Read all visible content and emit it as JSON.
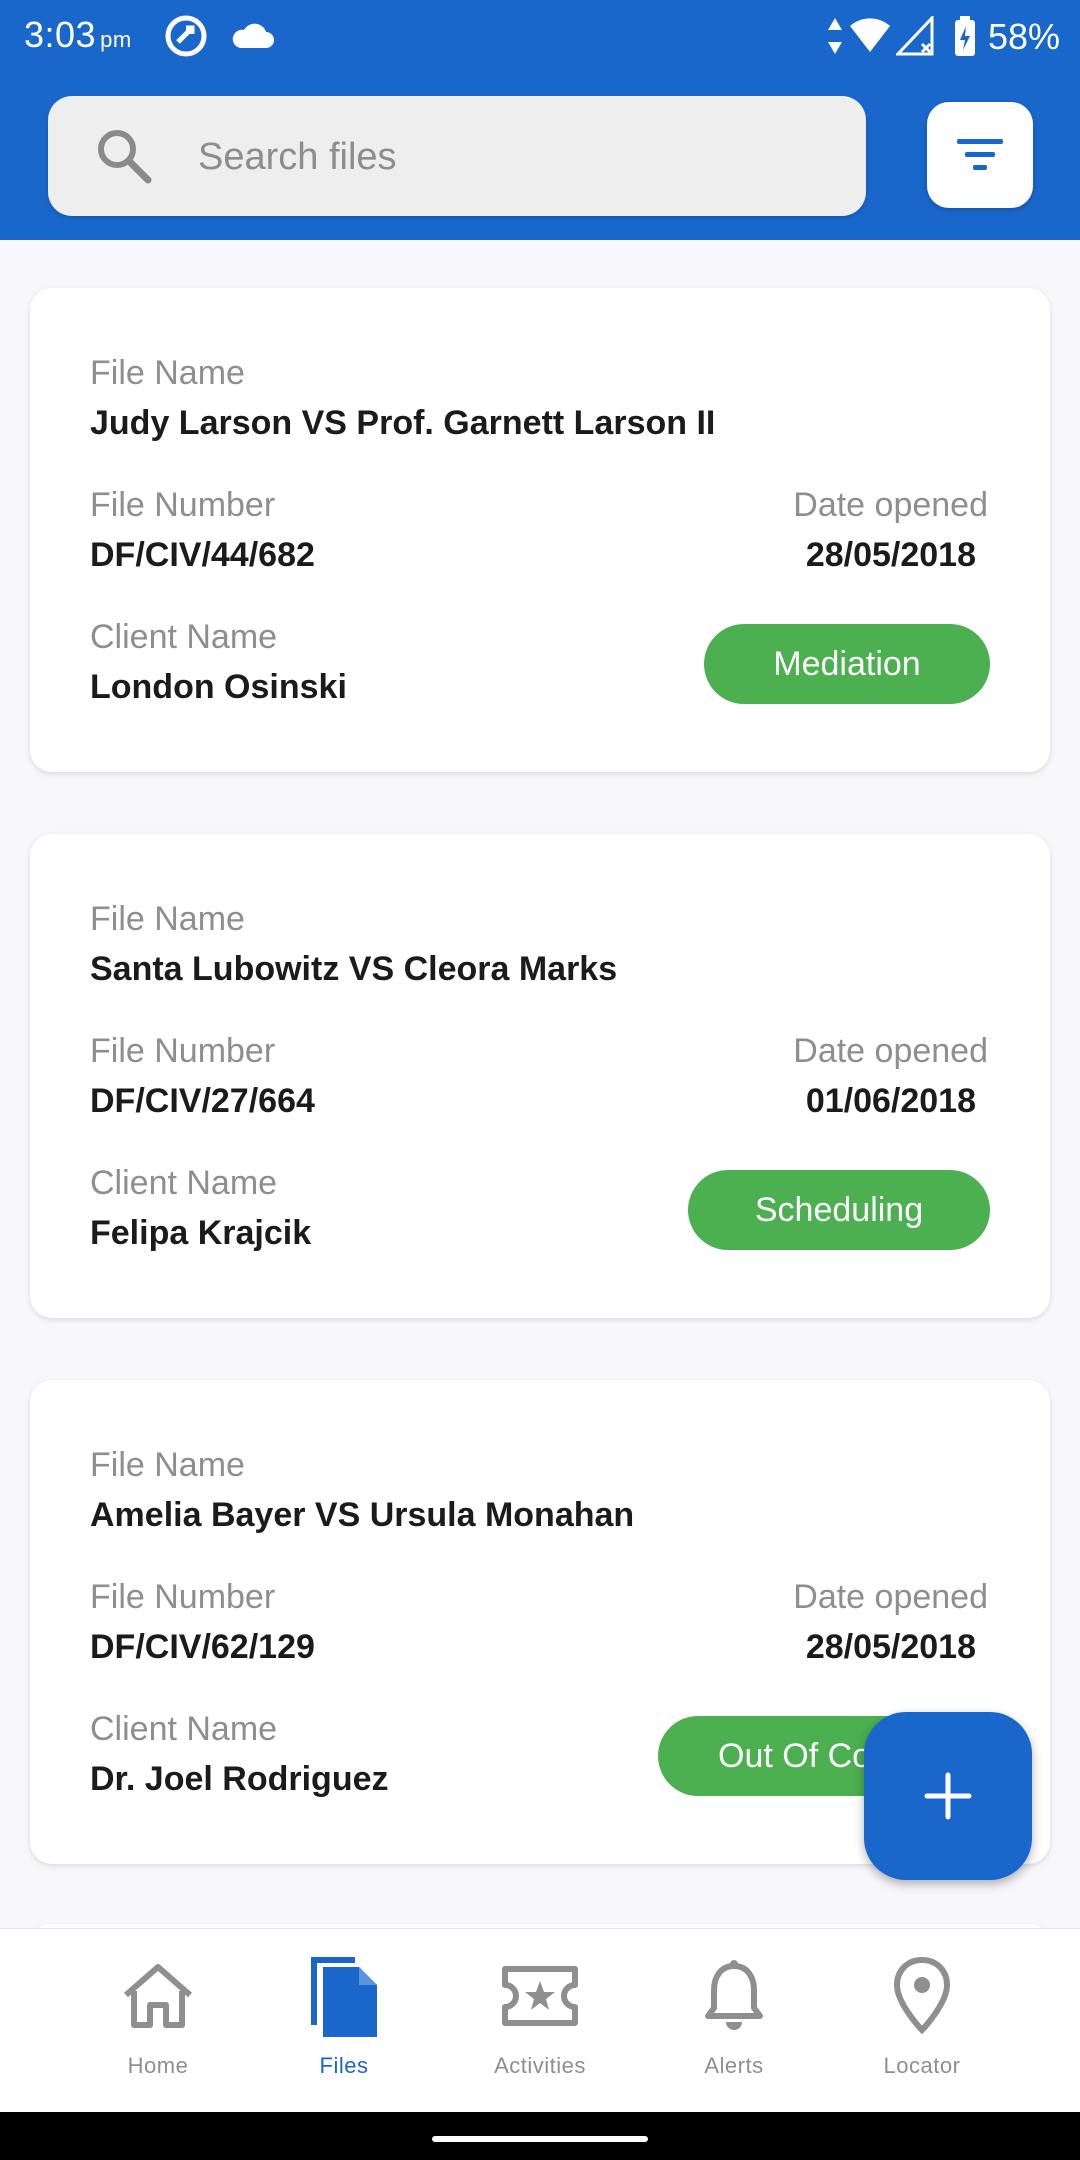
{
  "status_bar": {
    "time": "3:03",
    "ampm": "pm",
    "battery": "58%"
  },
  "search": {
    "placeholder": "Search files"
  },
  "labels": {
    "file_name": "File Name",
    "file_number": "File Number",
    "date_opened": "Date opened",
    "client_name": "Client Name"
  },
  "files": [
    {
      "name": "Judy Larson VS Prof. Garnett Larson II",
      "number": "DF/CIV/44/682",
      "date": "28/05/2018",
      "client": "London Osinski",
      "status": "Mediation"
    },
    {
      "name": "Santa Lubowitz VS Cleora Marks",
      "number": "DF/CIV/27/664",
      "date": "01/06/2018",
      "client": "Felipa Krajcik",
      "status": "Scheduling"
    },
    {
      "name": "Amelia Bayer VS Ursula Monahan",
      "number": "DF/CIV/62/129",
      "date": "28/05/2018",
      "client": "Dr. Joel Rodriguez",
      "status": "Out Of Co"
    }
  ],
  "fab": {
    "icon": "plus-icon"
  },
  "nav": {
    "items": [
      {
        "label": "Home",
        "icon": "home-icon"
      },
      {
        "label": "Files",
        "icon": "file-icon",
        "active": true
      },
      {
        "label": "Activities",
        "icon": "ticket-icon"
      },
      {
        "label": "Alerts",
        "icon": "bell-icon"
      },
      {
        "label": "Locator",
        "icon": "location-pin-icon"
      }
    ]
  },
  "colors": {
    "primary": "#1a67cc",
    "status_green": "#4caf50",
    "background": "#f8f7fc"
  }
}
